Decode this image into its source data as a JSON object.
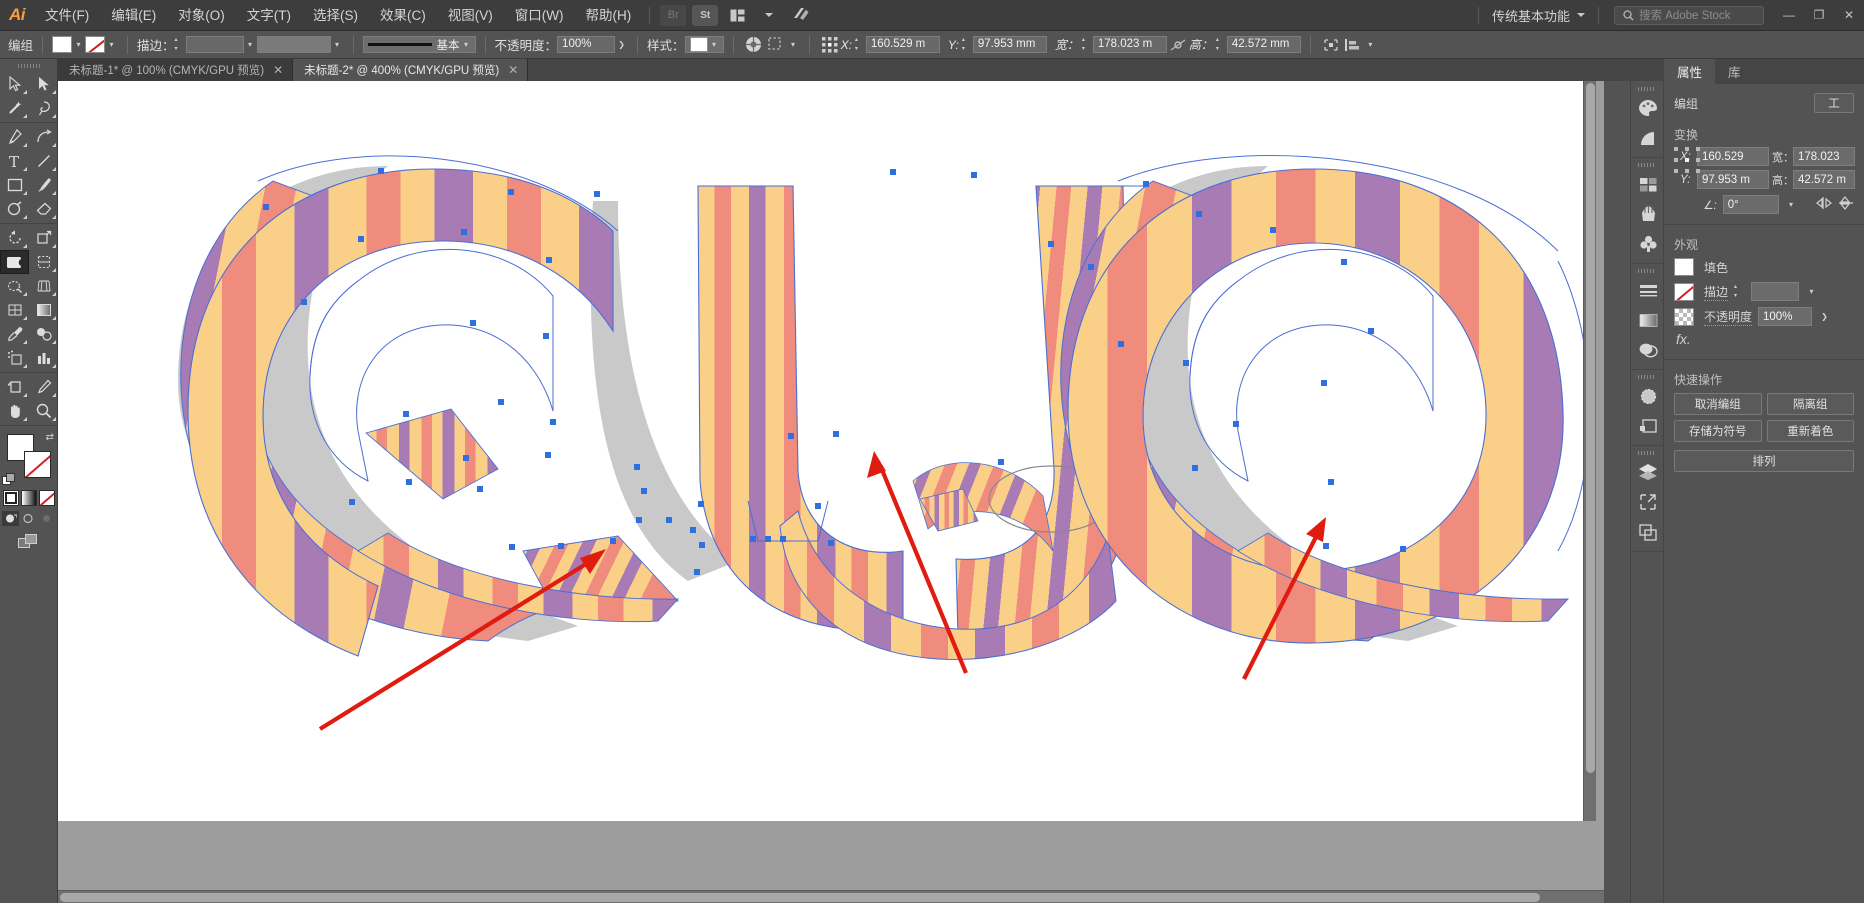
{
  "app": {
    "logo": "Ai",
    "title": "Adobe Illustrator"
  },
  "menubar": {
    "items": [
      {
        "label": "文件(F)",
        "name": "menu-file"
      },
      {
        "label": "编辑(E)",
        "name": "menu-edit"
      },
      {
        "label": "对象(O)",
        "name": "menu-object"
      },
      {
        "label": "文字(T)",
        "name": "menu-type"
      },
      {
        "label": "选择(S)",
        "name": "menu-select"
      },
      {
        "label": "效果(C)",
        "name": "menu-effect"
      },
      {
        "label": "视图(V)",
        "name": "menu-view"
      },
      {
        "label": "窗口(W)",
        "name": "menu-window"
      },
      {
        "label": "帮助(H)",
        "name": "menu-help"
      }
    ],
    "bridge_label": "Br",
    "stock_label": "St",
    "workspace": "传统基本功能",
    "search_placeholder": "搜索 Adobe Stock",
    "min_glyph": "—",
    "max_glyph": "❐",
    "close_glyph": "✕"
  },
  "controlbar": {
    "selection_label": "编组",
    "fill_color": "#ffffff",
    "stroke_label": "描边：",
    "stroke_weight": "",
    "stroke_profile": "",
    "brush_label": "基本",
    "opacity_label": "不透明度：",
    "opacity_value": "100%",
    "style_label": "样式：",
    "x_label": "X:",
    "x_value": "160.529 m",
    "y_label": "Y:",
    "y_value": "97.953 mm",
    "w_label": "宽：",
    "w_value": "178.023 m",
    "h_label": "高：",
    "h_value": "42.572 mm"
  },
  "tabs": [
    {
      "label": "未标题-1* @ 100% (CMYK/GPU 预览)",
      "active": false,
      "close": "✕"
    },
    {
      "label": "未标题-2* @ 400% (CMYK/GPU 预览)",
      "active": true,
      "close": "✕"
    }
  ],
  "toolbar": {
    "groups": [
      [
        {
          "name": "selection-tool",
          "label": "选择工具"
        },
        {
          "name": "direct-selection-tool",
          "label": "直接选择工具"
        },
        {
          "name": "magic-wand-tool",
          "label": "魔棒工具"
        },
        {
          "name": "lasso-tool",
          "label": "套索工具"
        }
      ],
      [
        {
          "name": "pen-tool",
          "label": "钢笔工具"
        },
        {
          "name": "curvature-tool",
          "label": "曲率工具"
        },
        {
          "name": "type-tool",
          "label": "文字工具"
        },
        {
          "name": "line-segment-tool",
          "label": "直线段工具"
        },
        {
          "name": "rectangle-tool",
          "label": "矩形工具"
        },
        {
          "name": "paintbrush-tool",
          "label": "画笔工具"
        },
        {
          "name": "shaper-tool",
          "label": "Shaper 工具"
        },
        {
          "name": "eraser-tool",
          "label": "橡皮擦工具"
        }
      ],
      [
        {
          "name": "rotate-tool",
          "label": "旋转工具"
        },
        {
          "name": "scale-tool",
          "label": "比例缩放工具"
        },
        {
          "name": "width-tool",
          "label": "宽度工具"
        },
        {
          "name": "free-transform-tool",
          "label": "自由变换工具"
        },
        {
          "name": "shape-builder-tool",
          "label": "形状生成器工具"
        },
        {
          "name": "perspective-grid-tool",
          "label": "透视网格工具"
        },
        {
          "name": "mesh-tool",
          "label": "网格工具"
        },
        {
          "name": "gradient-tool",
          "label": "渐变工具"
        },
        {
          "name": "eyedropper-tool",
          "label": "吸管工具"
        },
        {
          "name": "blend-tool",
          "label": "混合工具"
        },
        {
          "name": "symbol-sprayer-tool",
          "label": "符号喷枪工具"
        },
        {
          "name": "column-graph-tool",
          "label": "柱形图工具"
        }
      ],
      [
        {
          "name": "artboard-tool",
          "label": "画板工具"
        },
        {
          "name": "slice-tool",
          "label": "切片工具"
        },
        {
          "name": "hand-tool",
          "label": "抓手工具"
        },
        {
          "name": "zoom-tool",
          "label": "缩放工具"
        }
      ]
    ],
    "active_tool": "shape-builder-tool"
  },
  "dock_icons": [
    {
      "name": "color-panel-icon",
      "label": "颜色"
    },
    {
      "name": "color-guide-panel-icon",
      "label": "颜色参考"
    },
    {
      "name": "swatches-panel-icon",
      "label": "色板"
    },
    {
      "name": "brushes-panel-icon",
      "label": "画笔"
    },
    {
      "name": "symbols-panel-icon",
      "label": "符号"
    },
    {
      "name": "stroke-panel-icon",
      "label": "描边"
    },
    {
      "name": "gradient-panel-icon",
      "label": "渐变"
    },
    {
      "name": "transparency-panel-icon",
      "label": "透明度"
    },
    {
      "name": "appearance-panel-icon",
      "label": "外观"
    },
    {
      "name": "graphic-styles-panel-icon",
      "label": "图形样式"
    },
    {
      "name": "layers-panel-icon",
      "label": "图层"
    },
    {
      "name": "asset-export-panel-icon",
      "label": "资源导出"
    },
    {
      "name": "artboards-panel-icon",
      "label": "画板"
    }
  ],
  "properties": {
    "tabs": [
      {
        "label": "属性",
        "active": true
      },
      {
        "label": "库",
        "active": false
      }
    ],
    "object_type": "编组",
    "tool_button": "工",
    "transform": {
      "title": "变换",
      "x_label": "X:",
      "x_value": "160.529",
      "y_label": "Y:",
      "y_value": "97.953 m",
      "w_label": "宽：",
      "w_value": "178.023",
      "h_label": "高：",
      "h_value": "42.572 m",
      "angle_label": "∠:",
      "angle_value": "0°"
    },
    "appearance": {
      "title": "外观",
      "fill_label": "填色",
      "fill_color": "#ffffff",
      "stroke_label": "描边",
      "stroke_value": "",
      "opacity_label": "不透明度",
      "opacity_value": "100%",
      "fx_label": "fx."
    },
    "quick_actions": {
      "title": "快速操作",
      "buttons": [
        "取消编组",
        "隔离组",
        "存储为符号",
        "重新着色"
      ],
      "full_button": "排列"
    }
  },
  "canvas": {
    "zoom": "400%",
    "colors": {
      "stripe_yellow": "#fad089",
      "stripe_salmon": "#f08c7d",
      "stripe_purple": "#a87bb5",
      "shadow_gray": "#c9c9c9",
      "path_blue": "#4a6fd4",
      "anchor_blue": "#2f6fe0",
      "annotation_red": "#e01b10",
      "artboard_bg": "#ffffff",
      "canvas_bg": "#9d9d9d"
    },
    "artwork_text": "QUO",
    "annotations": [
      {
        "name": "arrow-annotation-left",
        "from": [
          260,
          648
        ],
        "to": [
          548,
          468
        ]
      },
      {
        "name": "arrow-annotation-middle",
        "from": [
          908,
          592
        ],
        "to": [
          816,
          370
        ]
      },
      {
        "name": "arrow-annotation-right",
        "from": [
          1186,
          598
        ],
        "to": [
          1268,
          436
        ]
      }
    ]
  }
}
